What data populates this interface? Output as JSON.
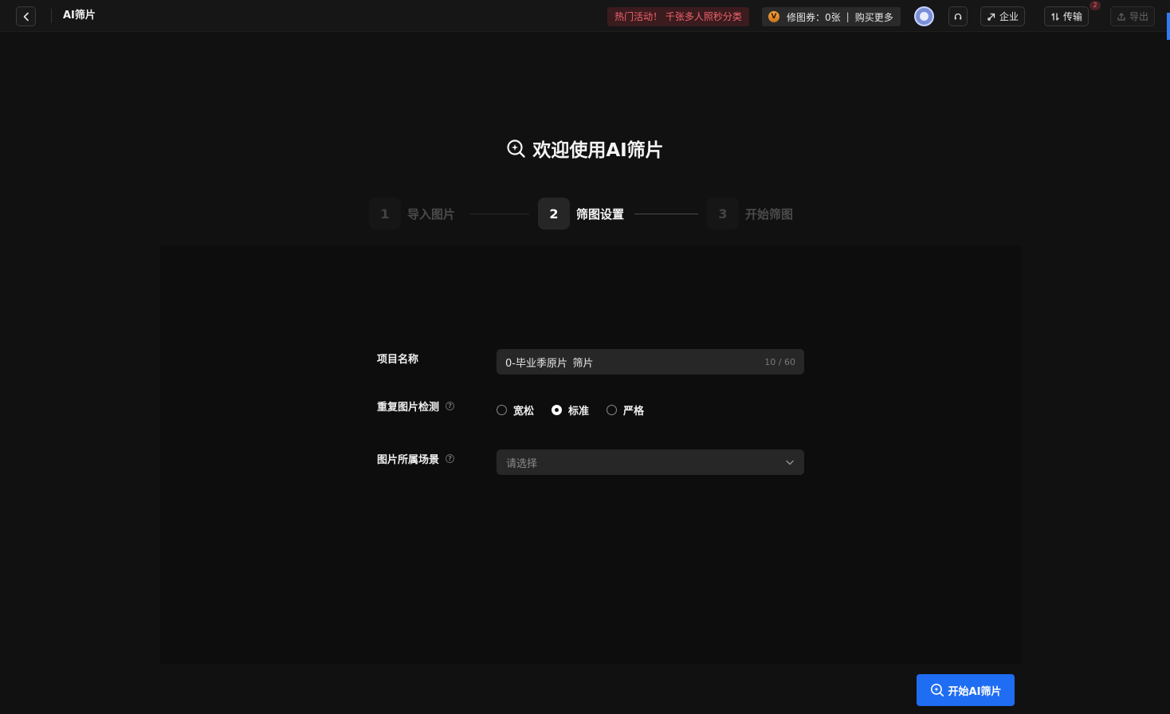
{
  "header": {
    "title": "AI筛片",
    "promo": "热门活动！ 千张多人照秒分类",
    "voucher": {
      "badge": "V",
      "label": "修图券：0张",
      "separator": "|",
      "buy": "购买更多"
    },
    "enterprise_label": "企业",
    "transfer_label": "传输",
    "transfer_badge": "2",
    "export_label": "导出"
  },
  "welcome": {
    "title": "欢迎使用AI筛片"
  },
  "steps": [
    {
      "num": "1",
      "label": "导入图片",
      "state": "inactive"
    },
    {
      "num": "2",
      "label": "筛图设置",
      "state": "active"
    },
    {
      "num": "3",
      "label": "开始筛图",
      "state": "inactive"
    }
  ],
  "form": {
    "project_name": {
      "label": "项目名称",
      "value": "0-毕业季原片_筛片",
      "counter": "10 / 60"
    },
    "duplicate_detection": {
      "label": "重复图片检测",
      "help": "?",
      "options": [
        "宽松",
        "标准",
        "严格"
      ],
      "selected": "标准"
    },
    "scene": {
      "label": "图片所属场景",
      "help": "?",
      "placeholder": "请选择"
    }
  },
  "start_button": {
    "label": "开始AI筛片"
  },
  "colors": {
    "accent": "#1f6df2",
    "promo_text": "#f0636d",
    "background": "#111111"
  }
}
